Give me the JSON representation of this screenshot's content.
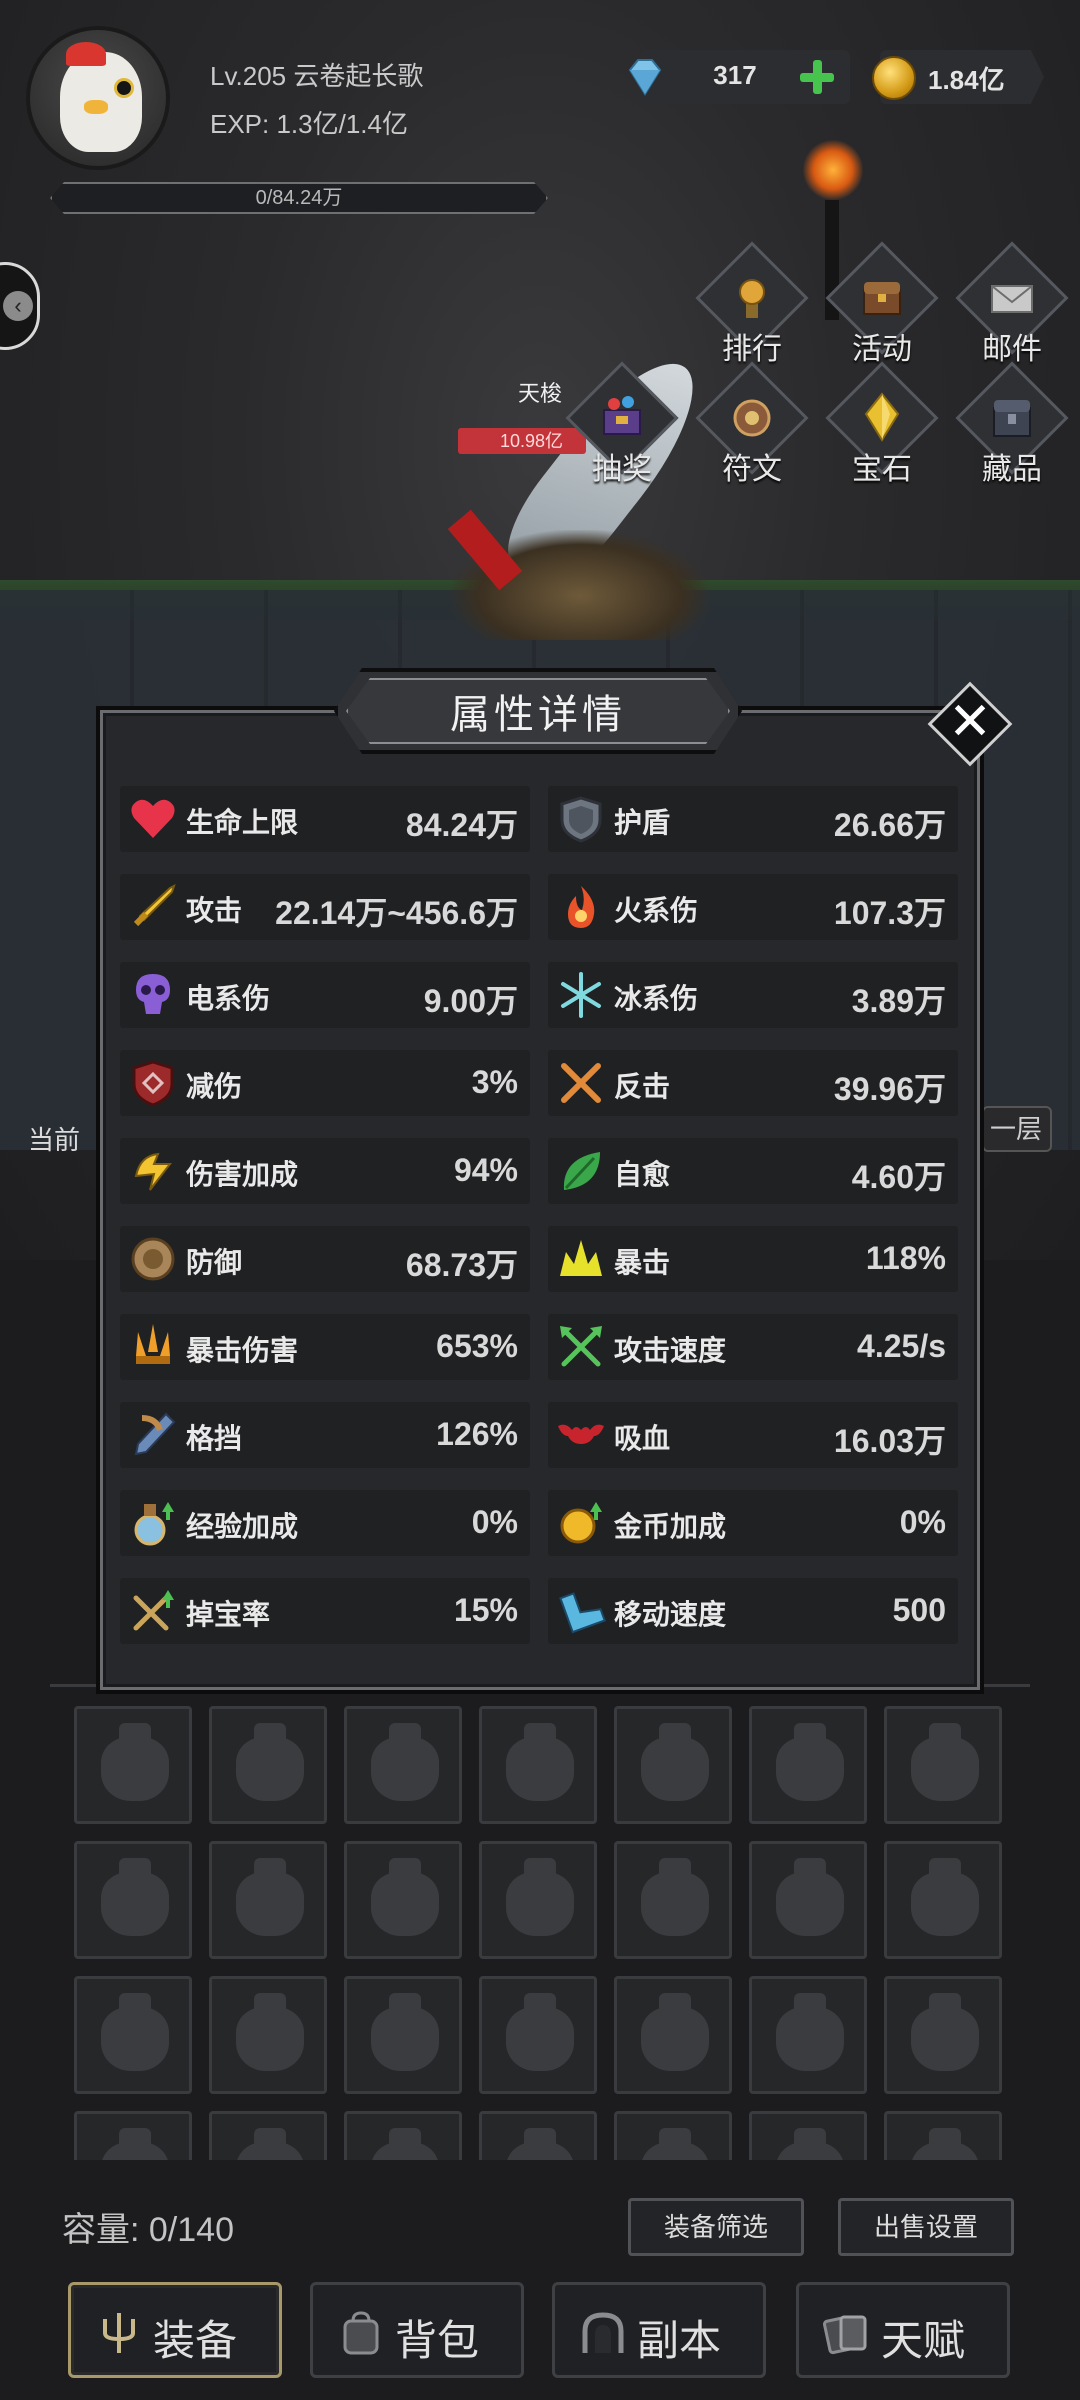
{
  "player": {
    "name_line": "Lv.205 云卷起长歌",
    "exp_line": "EXP: 1.3亿/1.4亿",
    "bar_text": "0/84.24万",
    "bar_progress": 0
  },
  "currency": {
    "gems": "317",
    "gold": "1.84亿"
  },
  "quick_menu": [
    {
      "label": "排行",
      "icon": "medal-icon"
    },
    {
      "label": "活动",
      "icon": "chest-icon"
    },
    {
      "label": "邮件",
      "icon": "mail-icon"
    },
    {
      "label": "抽奖",
      "icon": "lottery-chest-icon"
    },
    {
      "label": "符文",
      "icon": "rune-icon"
    },
    {
      "label": "宝石",
      "icon": "gem-crystal-icon"
    },
    {
      "label": "藏品",
      "icon": "collection-chest-icon"
    }
  ],
  "scene": {
    "enemy_name": "天梭",
    "enemy_hp": "10.98亿",
    "left_text": "当前",
    "right_tag": "一层"
  },
  "modal": {
    "title": "属性详情",
    "close_symbol": "✕",
    "stats": [
      {
        "name": "生命上限",
        "value": "84.24万",
        "icon": "heart-icon",
        "color": "#e8344a"
      },
      {
        "name": "护盾",
        "value": "26.66万",
        "icon": "shield-icon",
        "color": "#6d7580"
      },
      {
        "name": "攻击",
        "value": "22.14万~456.6万",
        "icon": "sword-icon",
        "color": "#f2c531"
      },
      {
        "name": "火系伤",
        "value": "107.3万",
        "icon": "fire-icon",
        "color": "#e8532a"
      },
      {
        "name": "电系伤",
        "value": "9.00万",
        "icon": "thunder-skull-icon",
        "color": "#8a5fd6"
      },
      {
        "name": "冰系伤",
        "value": "3.89万",
        "icon": "snowflake-icon",
        "color": "#7fd9df"
      },
      {
        "name": "减伤",
        "value": "3%",
        "icon": "damage-reduction-shield-icon",
        "color": "#9c2a2a"
      },
      {
        "name": "反击",
        "value": "39.96万",
        "icon": "crossed-swords-icon",
        "color": "#e08a3a"
      },
      {
        "name": "伤害加成",
        "value": "94%",
        "icon": "damage-bonus-icon",
        "color": "#f2c531"
      },
      {
        "name": "自愈",
        "value": "4.60万",
        "icon": "leaf-icon",
        "color": "#3aa84a"
      },
      {
        "name": "防御",
        "value": "68.73万",
        "icon": "round-shield-icon",
        "color": "#a8865a"
      },
      {
        "name": "暴击",
        "value": "118%",
        "icon": "crit-burst-icon",
        "color": "#e6e12a"
      },
      {
        "name": "暴击伤害",
        "value": "653%",
        "icon": "triple-blade-icon",
        "color": "#f0a02a"
      },
      {
        "name": "攻击速度",
        "value": "4.25/s",
        "icon": "attack-speed-arrows-icon",
        "color": "#56c45a"
      },
      {
        "name": "格挡",
        "value": "126%",
        "icon": "block-shield-icon",
        "color": "#6a8ab8"
      },
      {
        "name": "吸血",
        "value": "16.03万",
        "icon": "bat-icon",
        "color": "#c8242e"
      },
      {
        "name": "经验加成",
        "value": "0%",
        "icon": "exp-potion-icon",
        "color": "#d7b56a"
      },
      {
        "name": "金币加成",
        "value": "0%",
        "icon": "gold-bonus-icon",
        "color": "#f0b92a"
      },
      {
        "name": "掉宝率",
        "value": "15%",
        "icon": "loot-rate-icon",
        "color": "#c9a45a"
      },
      {
        "name": "移动速度",
        "value": "500",
        "icon": "boot-icon",
        "color": "#5ab8e0"
      }
    ]
  },
  "inventory": {
    "capacity": "容量: 0/140",
    "filter_label": "装备筛选",
    "sell_label": "出售设置"
  },
  "tabs": [
    {
      "label": "装备",
      "icon": "trident-icon",
      "active": true
    },
    {
      "label": "背包",
      "icon": "backpack-icon",
      "active": false
    },
    {
      "label": "副本",
      "icon": "dungeon-gate-icon",
      "active": false
    },
    {
      "label": "天赋",
      "icon": "talent-cards-icon",
      "active": false
    }
  ]
}
